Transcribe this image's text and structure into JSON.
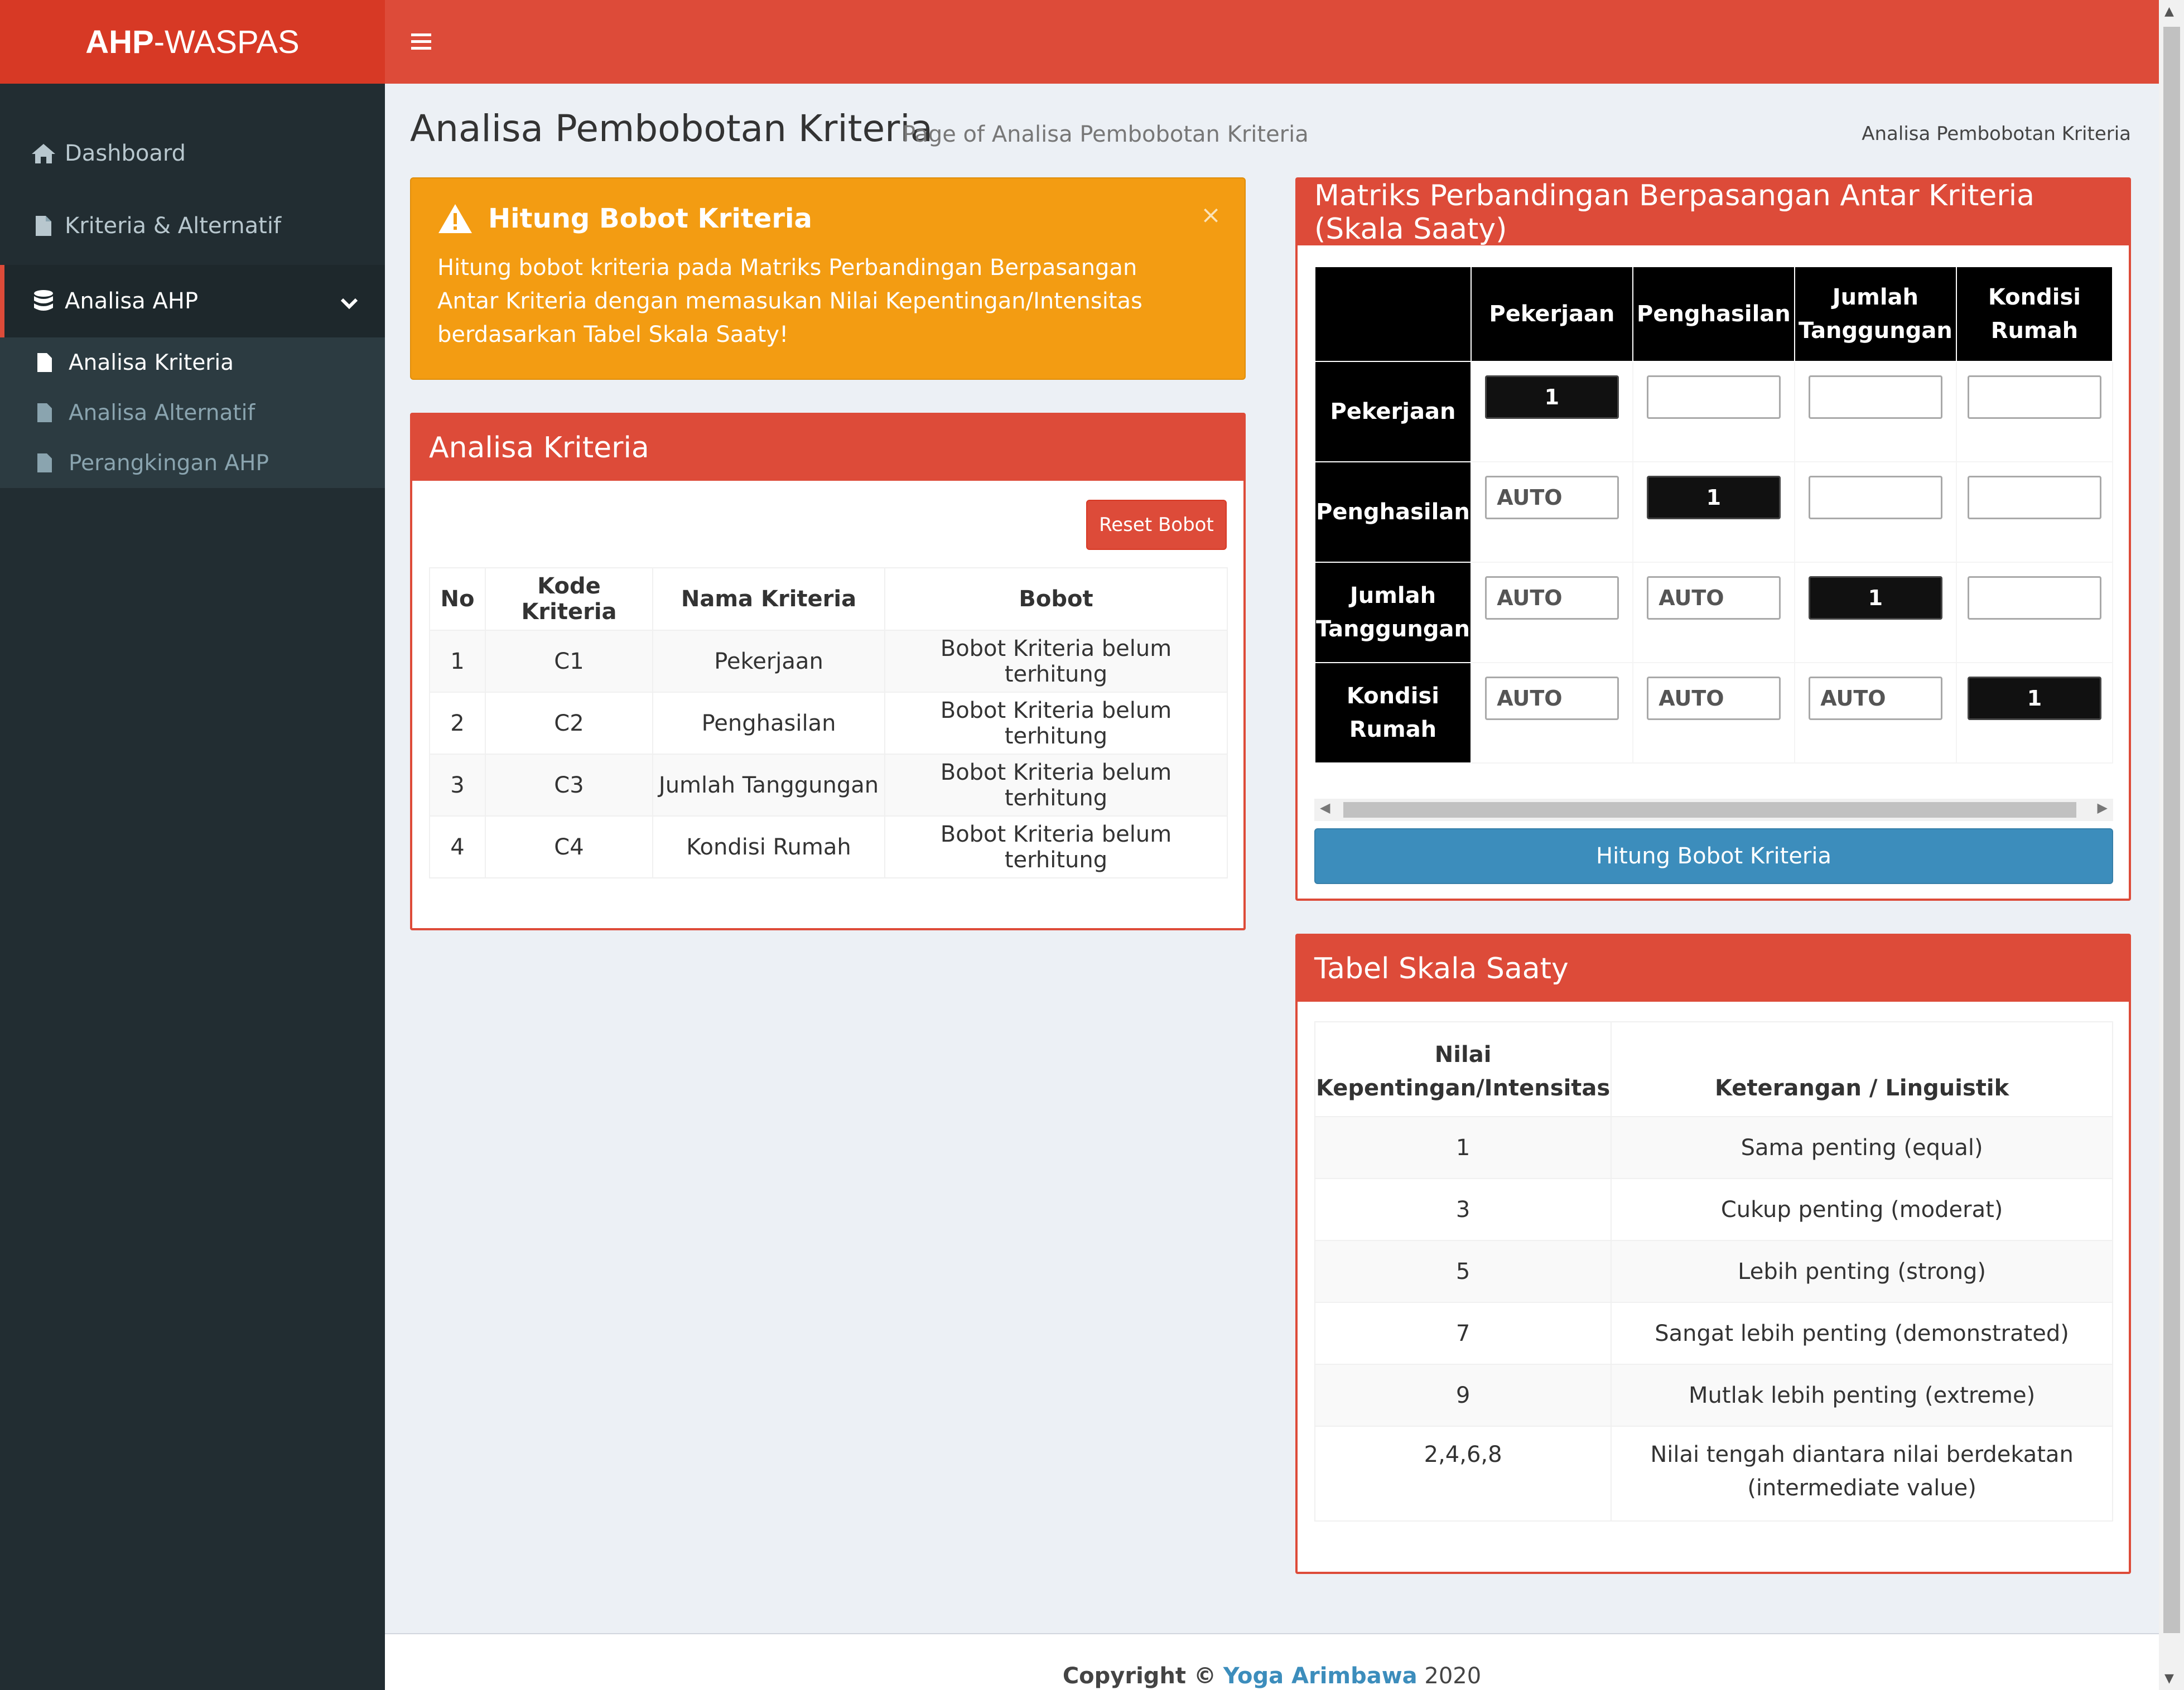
{
  "brand": {
    "bold": "AHP",
    "rest": "-WASPAS"
  },
  "sidebar": {
    "items": [
      {
        "label": "Dashboard",
        "icon": "home-icon"
      },
      {
        "label": "Kriteria & Alternatif",
        "icon": "file-icon"
      },
      {
        "label": "Analisa AHP",
        "icon": "database-icon"
      }
    ],
    "submenu": [
      {
        "label": "Analisa Kriteria",
        "icon": "file-icon"
      },
      {
        "label": "Analisa Alternatif",
        "icon": "file-icon"
      },
      {
        "label": "Perangkingan AHP",
        "icon": "file-icon"
      }
    ]
  },
  "header": {
    "title": "Analisa Pembobotan Kriteria",
    "subtitle": "Page of Analisa Pembobotan Kriteria",
    "breadcrumb": "Analisa Pembobotan Kriteria"
  },
  "alert": {
    "title": "Hitung Bobot Kriteria",
    "text": "Hitung bobot kriteria pada Matriks Perbandingan Berpasangan Antar Kriteria dengan memasukan Nilai Kepentingan/Intensitas berdasarkan Tabel Skala Saaty!",
    "close": "×",
    "color": "#f39c12"
  },
  "analisa": {
    "title": "Analisa Kriteria",
    "reset_label": "Reset Bobot",
    "columns": [
      "No",
      "Kode Kriteria",
      "Nama Kriteria",
      "Bobot"
    ],
    "rows": [
      [
        "1",
        "C1",
        "Pekerjaan",
        "Bobot Kriteria belum terhitung"
      ],
      [
        "2",
        "C2",
        "Penghasilan",
        "Bobot Kriteria belum terhitung"
      ],
      [
        "3",
        "C3",
        "Jumlah Tanggungan",
        "Bobot Kriteria belum terhitung"
      ],
      [
        "4",
        "C4",
        "Kondisi Rumah",
        "Bobot Kriteria belum terhitung"
      ]
    ]
  },
  "matrix": {
    "title": "Matriks Perbandingan Berpasangan Antar Kriteria (Skala Saaty)",
    "columns": [
      "Pekerjaan",
      "Penghasilan",
      "Jumlah Tanggungan",
      "Kondisi Rumah"
    ],
    "rows": [
      "Pekerjaan",
      "Penghasilan",
      "Jumlah Tanggungan",
      "Kondisi Rumah"
    ],
    "cells": [
      [
        "1",
        "",
        "",
        ""
      ],
      [
        "AUTO",
        "1",
        "",
        ""
      ],
      [
        "AUTO",
        "AUTO",
        "1",
        ""
      ],
      [
        "AUTO",
        "AUTO",
        "AUTO",
        "1"
      ]
    ],
    "button_label": "Hitung Bobot Kriteria"
  },
  "saaty": {
    "title": "Tabel Skala Saaty",
    "columns": [
      "Nilai Kepentingan/Intensitas",
      "Keterangan / Linguistik"
    ],
    "rows": [
      [
        "1",
        "Sama penting (equal)"
      ],
      [
        "3",
        "Cukup penting (moderat)"
      ],
      [
        "5",
        "Lebih penting (strong)"
      ],
      [
        "7",
        "Sangat lebih penting (demonstrated)"
      ],
      [
        "9",
        "Mutlak lebih penting (extreme)"
      ],
      [
        "2,4,6,8",
        "Nilai tengah diantara nilai berdekatan (intermediate value)"
      ]
    ]
  },
  "footer": {
    "prefix": "Copyright ©",
    "author": "Yoga Arimbawa",
    "year": "2020"
  },
  "colors": {
    "primary": "#dd4b39",
    "sidebar": "#222d32",
    "info": "#3c8dbc",
    "warning": "#f39c12"
  }
}
